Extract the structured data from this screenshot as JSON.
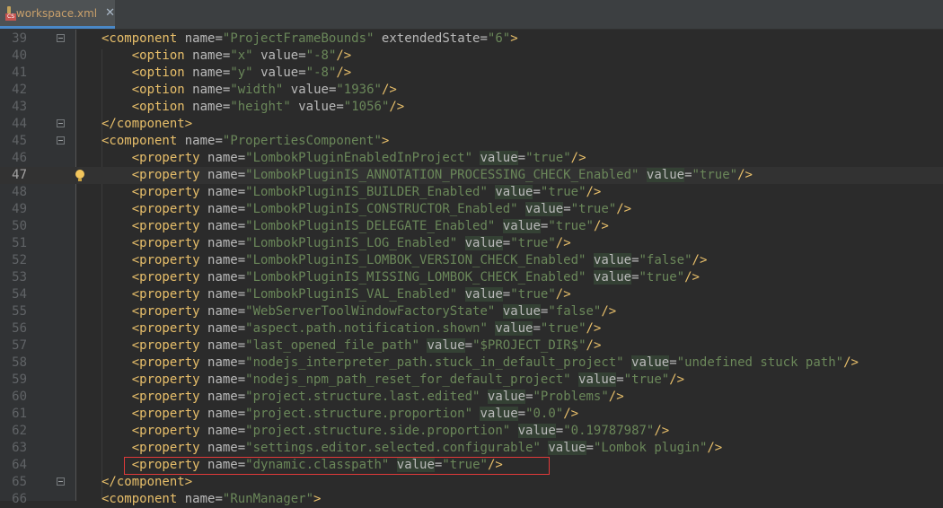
{
  "tab": {
    "file_name": "workspace.xml",
    "icon": "xml-file-icon",
    "close_glyph": "✕"
  },
  "colors": {
    "background": "#2b2b2b",
    "gutter": "#313335",
    "tag": "#e8bf6a",
    "attribute": "#bababa",
    "value": "#6a8759",
    "highlight_box": "#e03a3a"
  },
  "current_line": "47",
  "lines": [
    {
      "num": "39",
      "indent": "",
      "tokens": [
        [
          "t",
          "<component"
        ],
        [
          "s",
          " "
        ],
        [
          "a",
          "name"
        ],
        [
          "eq",
          "="
        ],
        [
          "v",
          "\"ProjectFrameBounds\""
        ],
        [
          "s",
          " "
        ],
        [
          "a",
          "extendedState"
        ],
        [
          "eq",
          "="
        ],
        [
          "v",
          "\"6\""
        ],
        [
          "t",
          ">"
        ]
      ]
    },
    {
      "num": "40",
      "indent": "    ",
      "tokens": [
        [
          "t",
          "<option"
        ],
        [
          "s",
          " "
        ],
        [
          "a",
          "name"
        ],
        [
          "eq",
          "="
        ],
        [
          "v",
          "\"x\""
        ],
        [
          "s",
          " "
        ],
        [
          "a",
          "value"
        ],
        [
          "eq",
          "="
        ],
        [
          "v",
          "\"-8\""
        ],
        [
          "t",
          "/>"
        ]
      ]
    },
    {
      "num": "41",
      "indent": "    ",
      "tokens": [
        [
          "t",
          "<option"
        ],
        [
          "s",
          " "
        ],
        [
          "a",
          "name"
        ],
        [
          "eq",
          "="
        ],
        [
          "v",
          "\"y\""
        ],
        [
          "s",
          " "
        ],
        [
          "a",
          "value"
        ],
        [
          "eq",
          "="
        ],
        [
          "v",
          "\"-8\""
        ],
        [
          "t",
          "/>"
        ]
      ]
    },
    {
      "num": "42",
      "indent": "    ",
      "tokens": [
        [
          "t",
          "<option"
        ],
        [
          "s",
          " "
        ],
        [
          "a",
          "name"
        ],
        [
          "eq",
          "="
        ],
        [
          "v",
          "\"width\""
        ],
        [
          "s",
          " "
        ],
        [
          "a",
          "value"
        ],
        [
          "eq",
          "="
        ],
        [
          "v",
          "\"1936\""
        ],
        [
          "t",
          "/>"
        ]
      ]
    },
    {
      "num": "43",
      "indent": "    ",
      "tokens": [
        [
          "t",
          "<option"
        ],
        [
          "s",
          " "
        ],
        [
          "a",
          "name"
        ],
        [
          "eq",
          "="
        ],
        [
          "v",
          "\"height\""
        ],
        [
          "s",
          " "
        ],
        [
          "a",
          "value"
        ],
        [
          "eq",
          "="
        ],
        [
          "v",
          "\"1056\""
        ],
        [
          "t",
          "/>"
        ]
      ]
    },
    {
      "num": "44",
      "indent": "",
      "tokens": [
        [
          "t",
          "</component>"
        ]
      ]
    },
    {
      "num": "45",
      "indent": "",
      "tokens": [
        [
          "t",
          "<component"
        ],
        [
          "s",
          " "
        ],
        [
          "a",
          "name"
        ],
        [
          "eq",
          "="
        ],
        [
          "v",
          "\"PropertiesComponent\""
        ],
        [
          "t",
          ">"
        ]
      ]
    },
    {
      "num": "46",
      "indent": "    ",
      "tokens": [
        [
          "t",
          "<property"
        ],
        [
          "s",
          " "
        ],
        [
          "a",
          "name"
        ],
        [
          "eq",
          "="
        ],
        [
          "v",
          "\"LombokPluginEnabledInProject\""
        ],
        [
          "s",
          " "
        ],
        [
          "av",
          "value"
        ],
        [
          "eq",
          "="
        ],
        [
          "v",
          "\"true\""
        ],
        [
          "t",
          "/>"
        ]
      ]
    },
    {
      "num": "47",
      "indent": "    ",
      "tokens": [
        [
          "t",
          "<property"
        ],
        [
          "s",
          " "
        ],
        [
          "a",
          "name"
        ],
        [
          "eq",
          "="
        ],
        [
          "v",
          "\"LombokPluginIS_ANNOTATION_PROCESSING_CHECK_Enabled\""
        ],
        [
          "s",
          " "
        ],
        [
          "av",
          "value"
        ],
        [
          "eq",
          "="
        ],
        [
          "v",
          "\"true\""
        ],
        [
          "t",
          "/>"
        ]
      ]
    },
    {
      "num": "48",
      "indent": "    ",
      "tokens": [
        [
          "t",
          "<property"
        ],
        [
          "s",
          " "
        ],
        [
          "a",
          "name"
        ],
        [
          "eq",
          "="
        ],
        [
          "v",
          "\"LombokPluginIS_BUILDER_Enabled\""
        ],
        [
          "s",
          " "
        ],
        [
          "av",
          "value"
        ],
        [
          "eq",
          "="
        ],
        [
          "v",
          "\"true\""
        ],
        [
          "t",
          "/>"
        ]
      ]
    },
    {
      "num": "49",
      "indent": "    ",
      "tokens": [
        [
          "t",
          "<property"
        ],
        [
          "s",
          " "
        ],
        [
          "a",
          "name"
        ],
        [
          "eq",
          "="
        ],
        [
          "v",
          "\"LombokPluginIS_CONSTRUCTOR_Enabled\""
        ],
        [
          "s",
          " "
        ],
        [
          "av",
          "value"
        ],
        [
          "eq",
          "="
        ],
        [
          "v",
          "\"true\""
        ],
        [
          "t",
          "/>"
        ]
      ]
    },
    {
      "num": "50",
      "indent": "    ",
      "tokens": [
        [
          "t",
          "<property"
        ],
        [
          "s",
          " "
        ],
        [
          "a",
          "name"
        ],
        [
          "eq",
          "="
        ],
        [
          "v",
          "\"LombokPluginIS_DELEGATE_Enabled\""
        ],
        [
          "s",
          " "
        ],
        [
          "av",
          "value"
        ],
        [
          "eq",
          "="
        ],
        [
          "v",
          "\"true\""
        ],
        [
          "t",
          "/>"
        ]
      ]
    },
    {
      "num": "51",
      "indent": "    ",
      "tokens": [
        [
          "t",
          "<property"
        ],
        [
          "s",
          " "
        ],
        [
          "a",
          "name"
        ],
        [
          "eq",
          "="
        ],
        [
          "v",
          "\"LombokPluginIS_LOG_Enabled\""
        ],
        [
          "s",
          " "
        ],
        [
          "av",
          "value"
        ],
        [
          "eq",
          "="
        ],
        [
          "v",
          "\"true\""
        ],
        [
          "t",
          "/>"
        ]
      ]
    },
    {
      "num": "52",
      "indent": "    ",
      "tokens": [
        [
          "t",
          "<property"
        ],
        [
          "s",
          " "
        ],
        [
          "a",
          "name"
        ],
        [
          "eq",
          "="
        ],
        [
          "v",
          "\"LombokPluginIS_LOMBOK_VERSION_CHECK_Enabled\""
        ],
        [
          "s",
          " "
        ],
        [
          "av",
          "value"
        ],
        [
          "eq",
          "="
        ],
        [
          "v",
          "\"false\""
        ],
        [
          "t",
          "/>"
        ]
      ]
    },
    {
      "num": "53",
      "indent": "    ",
      "tokens": [
        [
          "t",
          "<property"
        ],
        [
          "s",
          " "
        ],
        [
          "a",
          "name"
        ],
        [
          "eq",
          "="
        ],
        [
          "v",
          "\"LombokPluginIS_MISSING_LOMBOK_CHECK_Enabled\""
        ],
        [
          "s",
          " "
        ],
        [
          "av",
          "value"
        ],
        [
          "eq",
          "="
        ],
        [
          "v",
          "\"true\""
        ],
        [
          "t",
          "/>"
        ]
      ]
    },
    {
      "num": "54",
      "indent": "    ",
      "tokens": [
        [
          "t",
          "<property"
        ],
        [
          "s",
          " "
        ],
        [
          "a",
          "name"
        ],
        [
          "eq",
          "="
        ],
        [
          "v",
          "\"LombokPluginIS_VAL_Enabled\""
        ],
        [
          "s",
          " "
        ],
        [
          "av",
          "value"
        ],
        [
          "eq",
          "="
        ],
        [
          "v",
          "\"true\""
        ],
        [
          "t",
          "/>"
        ]
      ]
    },
    {
      "num": "55",
      "indent": "    ",
      "tokens": [
        [
          "t",
          "<property"
        ],
        [
          "s",
          " "
        ],
        [
          "a",
          "name"
        ],
        [
          "eq",
          "="
        ],
        [
          "v",
          "\"WebServerToolWindowFactoryState\""
        ],
        [
          "s",
          " "
        ],
        [
          "av",
          "value"
        ],
        [
          "eq",
          "="
        ],
        [
          "v",
          "\"false\""
        ],
        [
          "t",
          "/>"
        ]
      ]
    },
    {
      "num": "56",
      "indent": "    ",
      "tokens": [
        [
          "t",
          "<property"
        ],
        [
          "s",
          " "
        ],
        [
          "a",
          "name"
        ],
        [
          "eq",
          "="
        ],
        [
          "v",
          "\"aspect.path.notification.shown\""
        ],
        [
          "s",
          " "
        ],
        [
          "av",
          "value"
        ],
        [
          "eq",
          "="
        ],
        [
          "v",
          "\"true\""
        ],
        [
          "t",
          "/>"
        ]
      ]
    },
    {
      "num": "57",
      "indent": "    ",
      "tokens": [
        [
          "t",
          "<property"
        ],
        [
          "s",
          " "
        ],
        [
          "a",
          "name"
        ],
        [
          "eq",
          "="
        ],
        [
          "v",
          "\"last_opened_file_path\""
        ],
        [
          "s",
          " "
        ],
        [
          "av",
          "value"
        ],
        [
          "eq",
          "="
        ],
        [
          "v",
          "\"$PROJECT_DIR$\""
        ],
        [
          "t",
          "/>"
        ]
      ]
    },
    {
      "num": "58",
      "indent": "    ",
      "tokens": [
        [
          "t",
          "<property"
        ],
        [
          "s",
          " "
        ],
        [
          "a",
          "name"
        ],
        [
          "eq",
          "="
        ],
        [
          "v",
          "\"nodejs_interpreter_path.stuck_in_default_project\""
        ],
        [
          "s",
          " "
        ],
        [
          "av",
          "value"
        ],
        [
          "eq",
          "="
        ],
        [
          "v",
          "\"undefined stuck path\""
        ],
        [
          "t",
          "/>"
        ]
      ]
    },
    {
      "num": "59",
      "indent": "    ",
      "tokens": [
        [
          "t",
          "<property"
        ],
        [
          "s",
          " "
        ],
        [
          "a",
          "name"
        ],
        [
          "eq",
          "="
        ],
        [
          "v",
          "\"nodejs_npm_path_reset_for_default_project\""
        ],
        [
          "s",
          " "
        ],
        [
          "av",
          "value"
        ],
        [
          "eq",
          "="
        ],
        [
          "v",
          "\"true\""
        ],
        [
          "t",
          "/>"
        ]
      ]
    },
    {
      "num": "60",
      "indent": "    ",
      "tokens": [
        [
          "t",
          "<property"
        ],
        [
          "s",
          " "
        ],
        [
          "a",
          "name"
        ],
        [
          "eq",
          "="
        ],
        [
          "v",
          "\"project.structure.last.edited\""
        ],
        [
          "s",
          " "
        ],
        [
          "av",
          "value"
        ],
        [
          "eq",
          "="
        ],
        [
          "v",
          "\"Problems\""
        ],
        [
          "t",
          "/>"
        ]
      ]
    },
    {
      "num": "61",
      "indent": "    ",
      "tokens": [
        [
          "t",
          "<property"
        ],
        [
          "s",
          " "
        ],
        [
          "a",
          "name"
        ],
        [
          "eq",
          "="
        ],
        [
          "v",
          "\"project.structure.proportion\""
        ],
        [
          "s",
          " "
        ],
        [
          "av",
          "value"
        ],
        [
          "eq",
          "="
        ],
        [
          "v",
          "\"0.0\""
        ],
        [
          "t",
          "/>"
        ]
      ]
    },
    {
      "num": "62",
      "indent": "    ",
      "tokens": [
        [
          "t",
          "<property"
        ],
        [
          "s",
          " "
        ],
        [
          "a",
          "name"
        ],
        [
          "eq",
          "="
        ],
        [
          "v",
          "\"project.structure.side.proportion\""
        ],
        [
          "s",
          " "
        ],
        [
          "av",
          "value"
        ],
        [
          "eq",
          "="
        ],
        [
          "v",
          "\"0.19787987\""
        ],
        [
          "t",
          "/>"
        ]
      ]
    },
    {
      "num": "63",
      "indent": "    ",
      "tokens": [
        [
          "t",
          "<property"
        ],
        [
          "s",
          " "
        ],
        [
          "a",
          "name"
        ],
        [
          "eq",
          "="
        ],
        [
          "v",
          "\"settings.editor.selected.configurable\""
        ],
        [
          "s",
          " "
        ],
        [
          "av",
          "value"
        ],
        [
          "eq",
          "="
        ],
        [
          "v",
          "\"Lombok plugin\""
        ],
        [
          "t",
          "/>"
        ]
      ]
    },
    {
      "num": "64",
      "indent": "    ",
      "tokens": [
        [
          "t",
          "<property"
        ],
        [
          "s",
          " "
        ],
        [
          "a",
          "name"
        ],
        [
          "eq",
          "="
        ],
        [
          "v",
          "\"dynamic.classpath\""
        ],
        [
          "s",
          " "
        ],
        [
          "av",
          "value"
        ],
        [
          "eq",
          "="
        ],
        [
          "v",
          "\"true\""
        ],
        [
          "t",
          "/>"
        ]
      ]
    },
    {
      "num": "65",
      "indent": "",
      "tokens": [
        [
          "t",
          "</component>"
        ]
      ]
    },
    {
      "num": "66",
      "indent": "",
      "tokens": [
        [
          "t",
          "<component"
        ],
        [
          "s",
          " "
        ],
        [
          "a",
          "name"
        ],
        [
          "eq",
          "="
        ],
        [
          "v",
          "\"RunManager\""
        ],
        [
          "t",
          ">"
        ]
      ]
    }
  ]
}
